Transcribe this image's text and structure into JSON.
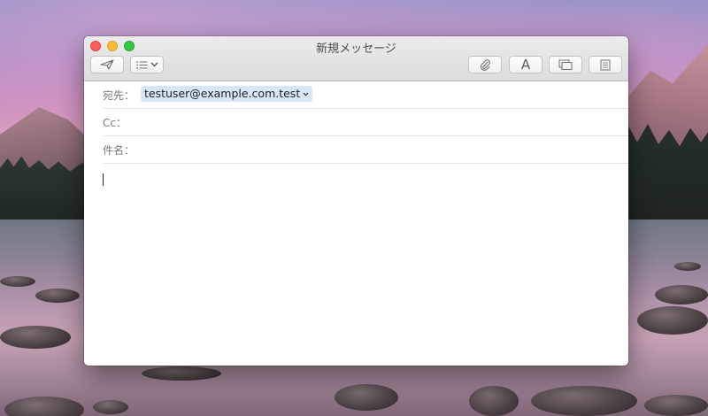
{
  "window": {
    "title": "新規メッセージ"
  },
  "toolbar": {
    "send_icon": "paper-plane-icon",
    "header_fields_icon": "list-icon",
    "attach_icon": "paperclip-icon",
    "format_label": "A",
    "photo_icon": "photo-browser-icon",
    "template_icon": "stationery-icon"
  },
  "fields": {
    "to_label": "宛先：",
    "to_recipient": "testuser@example.com.test",
    "cc_label": "Cc：",
    "subject_label": "件名："
  },
  "colors": {
    "close": "#fc5f57",
    "minimize": "#fdbc2e",
    "zoom": "#33c748",
    "recipient_token": "#d7e7f9"
  }
}
